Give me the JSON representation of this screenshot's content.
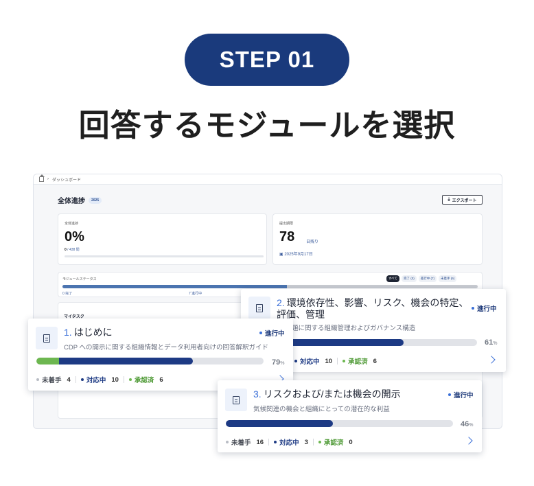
{
  "step": {
    "label": "STEP 01"
  },
  "headline": "回答するモジュールを選択",
  "dashboard": {
    "breadcrumb": "ダッシュボード",
    "title": "全体進捗",
    "year": "2025",
    "export_label": "エクスポート",
    "overall": {
      "label": "全体進捗",
      "value": "0%",
      "done": "0",
      "total": "/ 438 問"
    },
    "deadline": {
      "label": "提出期限",
      "value": "78",
      "unit": "日残り",
      "date": "2025年9月17日"
    },
    "module_status": {
      "label": "モジュールステータス",
      "progress": 0.54,
      "chips": [
        "すべて",
        "完了 (0)",
        "進行中 (7)",
        "未着手 (6)"
      ],
      "legend_done": "0 完了",
      "legend_doing": "7 進行中"
    },
    "mytask": {
      "label": "マイタスク"
    }
  },
  "cards": [
    {
      "number": "1.",
      "title": "はじめに",
      "title_line2": "",
      "description": "CDP への開示に関する組織情報とデータ利用者向けの回答解釈ガイド",
      "status": "進行中",
      "approved_fraction": 0.1,
      "progress_fraction": 0.69,
      "percent": "79",
      "percent_unit": "%",
      "stats": {
        "todo_label": "未着手",
        "todo": "4",
        "doing_label": "対応中",
        "doing": "10",
        "done_label": "承認済",
        "done": "6"
      }
    },
    {
      "number": "2.",
      "title": "環境依存性、影響、リスク、機会の特定、",
      "title_line2": "評価、管理",
      "description": "題に関する組織管理およびガバナンス構造",
      "status": "進行中",
      "approved_fraction": 0,
      "progress_fraction": 0.61,
      "percent": "61",
      "percent_unit": "%",
      "stats": {
        "doing_label": "対応中",
        "doing": "10",
        "done_label": "承認済",
        "done": "6"
      }
    },
    {
      "number": "3.",
      "title": "リスクおよび/または機会の開示",
      "title_line2": "",
      "description": "気候関連の機会と組織にとっての潜在的な利益",
      "status": "進行中",
      "approved_fraction": 0,
      "progress_fraction": 0.47,
      "percent": "46",
      "percent_unit": "%",
      "stats": {
        "todo_label": "未着手",
        "todo": "16",
        "doing_label": "対応中",
        "doing": "3",
        "done_label": "承認済",
        "done": "0"
      }
    }
  ],
  "colors": {
    "navy": "#1a3a7c",
    "progress_blue": "#1d3a84",
    "approved_green": "#6db750",
    "accent_blue": "#3a6fd8"
  }
}
